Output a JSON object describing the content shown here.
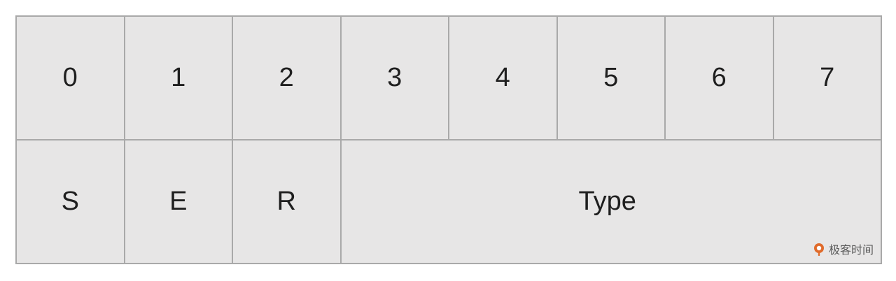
{
  "bits": [
    "0",
    "1",
    "2",
    "3",
    "4",
    "5",
    "6",
    "7"
  ],
  "fields": {
    "s": "S",
    "e": "E",
    "r": "R",
    "type": "Type"
  },
  "watermark": {
    "text": "极客时间",
    "icon": "geektime-logo-icon",
    "color": "#e06b2b"
  },
  "colors": {
    "cell_fill": "#e7e6e6",
    "border": "#a9a9a9",
    "text": "#1f1f1f"
  }
}
